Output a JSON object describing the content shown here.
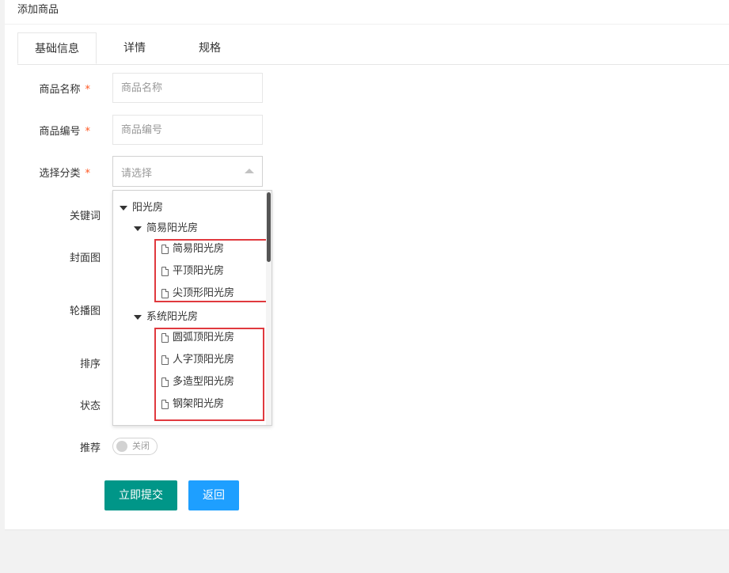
{
  "panel": {
    "title": "添加商品"
  },
  "tabs": [
    {
      "label": "基础信息",
      "active": true
    },
    {
      "label": "详情",
      "active": false
    },
    {
      "label": "规格",
      "active": false
    }
  ],
  "form": {
    "name_label": "商品名称",
    "name_placeholder": "商品名称",
    "code_label": "商品编号",
    "code_placeholder": "商品编号",
    "category_label": "选择分类",
    "category_placeholder": "请选择",
    "keywords_label": "关键词",
    "cover_label": "封面图",
    "carousel_label": "轮播图",
    "sort_label": "排序",
    "status_label": "状态",
    "recommend_label": "推荐",
    "required_mark": "*",
    "recommend_switch_text": "关闭"
  },
  "category_tree": {
    "root": "阳光房",
    "group1": {
      "label": "简易阳光房",
      "items": [
        "简易阳光房",
        "平顶阳光房",
        "尖顶形阳光房"
      ]
    },
    "group2": {
      "label": "系统阳光房",
      "items": [
        "圆弧顶阳光房",
        "人字顶阳光房",
        "多造型阳光房",
        "钢架阳光房"
      ]
    }
  },
  "buttons": {
    "submit": "立即提交",
    "back": "返回"
  },
  "colors": {
    "submit_bg": "#009688",
    "back_bg": "#1e9fff",
    "required": "#ff5722",
    "highlight": "#e0393e"
  }
}
